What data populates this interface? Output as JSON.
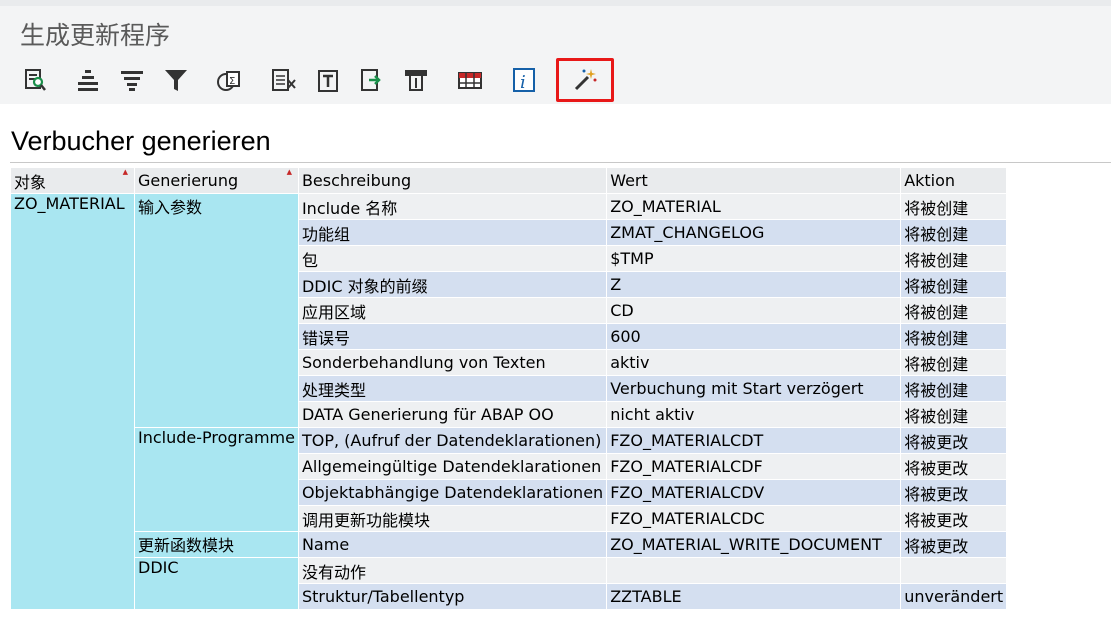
{
  "window": {
    "title": "生成更新程序"
  },
  "toolbar": {
    "buttons": [
      {
        "icon": "find-icon"
      },
      {
        "icon": "align-center-icon"
      },
      {
        "icon": "align-bottom-icon"
      },
      {
        "icon": "filter-icon"
      },
      {
        "icon": "sum-icon"
      },
      {
        "icon": "export-table-icon"
      },
      {
        "icon": "text-icon"
      },
      {
        "icon": "send-icon"
      },
      {
        "icon": "print-icon"
      },
      {
        "icon": "layout-icon"
      },
      {
        "icon": "info-icon"
      },
      {
        "icon": "magic-wand-icon"
      }
    ],
    "selected_color": "#e81818"
  },
  "main": {
    "heading": "Verbucher generieren",
    "columns": [
      "对象",
      "Generierung",
      "Beschreibung",
      "Wert",
      "Aktion"
    ],
    "object": "ZO_MATERIAL",
    "groups": [
      {
        "label": "输入参数",
        "rows": [
          {
            "desc": "Include 名称",
            "value": "ZO_MATERIAL",
            "action": "将被创建"
          },
          {
            "desc": "功能组",
            "value": "ZMAT_CHANGELOG",
            "action": "将被创建"
          },
          {
            "desc": "包",
            "value": "$TMP",
            "action": "将被创建"
          },
          {
            "desc": "DDIC 对象的前缀",
            "value": "Z",
            "action": "将被创建"
          },
          {
            "desc": "应用区域",
            "value": "CD",
            "action": "将被创建"
          },
          {
            "desc": "错误号",
            "value": "600",
            "action": "将被创建"
          },
          {
            "desc": "Sonderbehandlung von Texten",
            "value": "aktiv",
            "action": "将被创建"
          },
          {
            "desc": "处理类型",
            "value": "Verbuchung mit Start verzögert",
            "action": "将被创建"
          },
          {
            "desc": "DATA Generierung für ABAP OO",
            "value": "nicht aktiv",
            "action": "将被创建"
          }
        ]
      },
      {
        "label": "Include-Programme",
        "rows": [
          {
            "desc": "TOP, (Aufruf der Datendeklarationen)",
            "value": "FZO_MATERIALCDT",
            "action": "将被更改"
          },
          {
            "desc": "Allgemeingültige Datendeklarationen",
            "value": "FZO_MATERIALCDF",
            "action": "将被更改"
          },
          {
            "desc": "Objektabhängige Datendeklarationen",
            "value": "FZO_MATERIALCDV",
            "action": "将被更改"
          },
          {
            "desc": "调用更新功能模块",
            "value": "FZO_MATERIALCDC",
            "action": "将被更改"
          }
        ]
      },
      {
        "label": "更新函数模块",
        "rows": [
          {
            "desc": "Name",
            "value": "ZO_MATERIAL_WRITE_DOCUMENT",
            "action": "将被更改"
          }
        ]
      },
      {
        "label": "DDIC",
        "rows": [
          {
            "desc": "没有动作",
            "value": "",
            "action": ""
          },
          {
            "desc": "Struktur/Tabellentyp",
            "value": "ZZTABLE",
            "action": "unverändert"
          }
        ]
      }
    ]
  }
}
